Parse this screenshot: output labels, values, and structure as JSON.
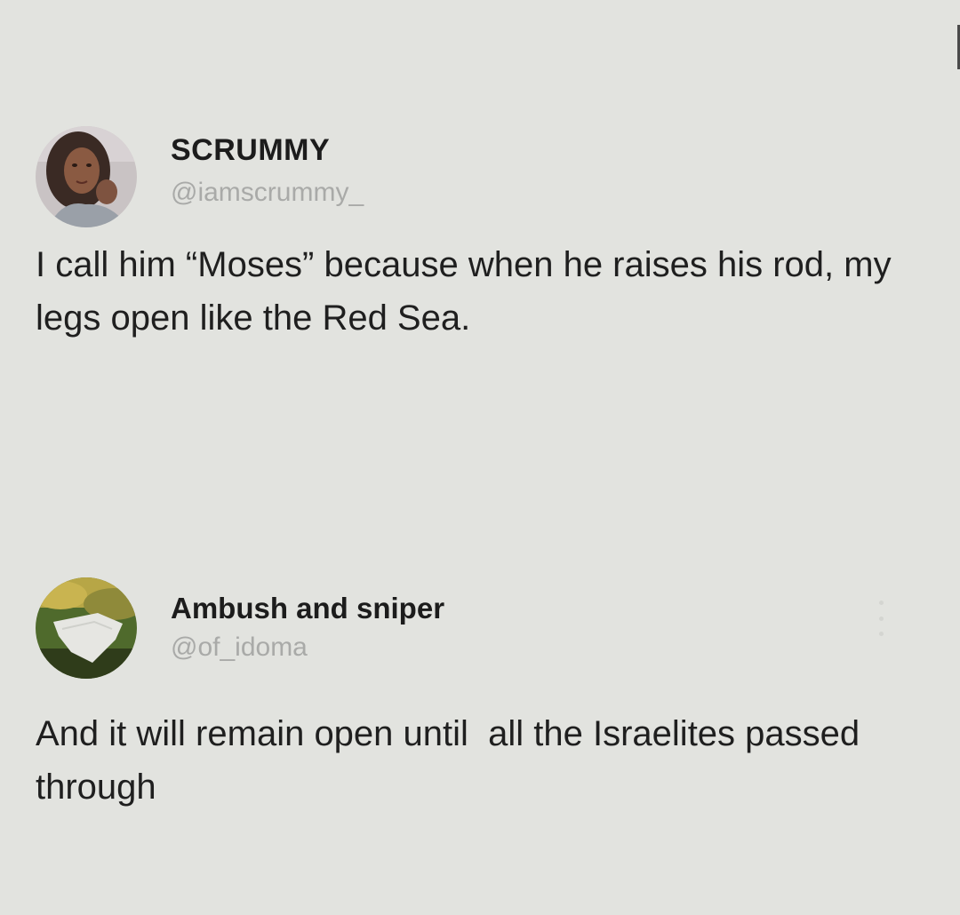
{
  "posts": [
    {
      "display_name": "SCRUMMY",
      "handle": "@iamscrummy_",
      "text": "I call him “Moses” because when he raises his rod, my legs open like the Red Sea.",
      "avatar_icon": "profile-photo-woman"
    },
    {
      "display_name": "Ambush and sniper",
      "handle": "@of_idoma",
      "text": "And it will remain open until  all the Israelites passed through",
      "avatar_icon": "profile-photo-landscape",
      "menu_icon": "vertical-ellipsis-icon"
    }
  ],
  "colors": {
    "background": "#e2e3df",
    "text": "#1f1f1f",
    "handle": "#a9aaa8"
  }
}
